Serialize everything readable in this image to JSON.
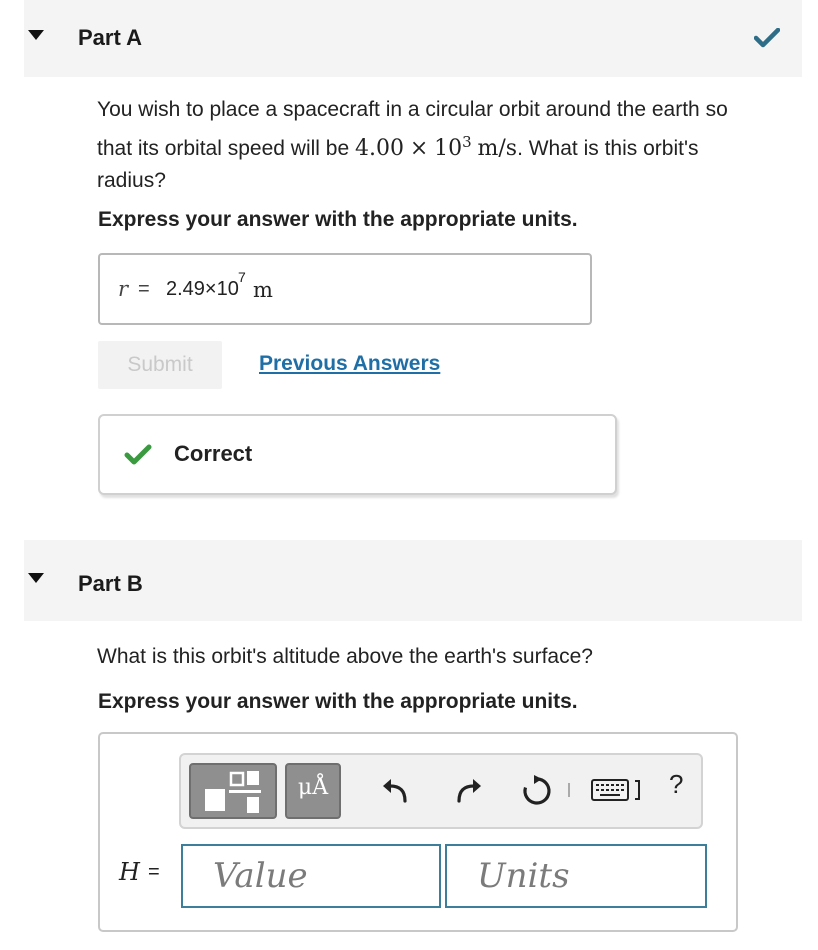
{
  "part_a": {
    "title": "Part A",
    "prompt_text_1": "You wish to place a spacecraft in a circular orbit around the earth so",
    "prompt_text_2": "that its orbital speed will be",
    "speed_mantissa": "4.00",
    "times": "×",
    "speed_base": "10",
    "speed_exp": "3",
    "speed_units": "m/s",
    "prompt_text_3": ". What is this orbit's",
    "prompt_text_4": "radius?",
    "instruction": "Express your answer with the appropriate units.",
    "answer": {
      "variable": "r",
      "equals": "=",
      "value": "2.49×10",
      "exponent": "7",
      "unit": "m"
    },
    "submit_label": "Submit",
    "previous_answers_label": "Previous Answers",
    "feedback_label": "Correct"
  },
  "part_b": {
    "title": "Part B",
    "prompt": "What is this orbit's altitude above the earth's surface?",
    "instruction": "Express your answer with the appropriate units.",
    "toolbar": {
      "units_button_label": "μÅ",
      "help_label": "?",
      "icons": [
        "templates-icon",
        "units-icon",
        "undo-icon",
        "redo-icon",
        "reset-icon",
        "keyboard-icon",
        "help-icon"
      ]
    },
    "variable": "H",
    "equals": "=",
    "value_placeholder": "Value",
    "units_placeholder": "Units"
  },
  "colors": {
    "header_bg": "#f4f4f4",
    "check_blue": "#2e6d87",
    "check_green": "#3a9a3f",
    "link": "#1f6fa6",
    "field_border": "#3d7f9b"
  }
}
